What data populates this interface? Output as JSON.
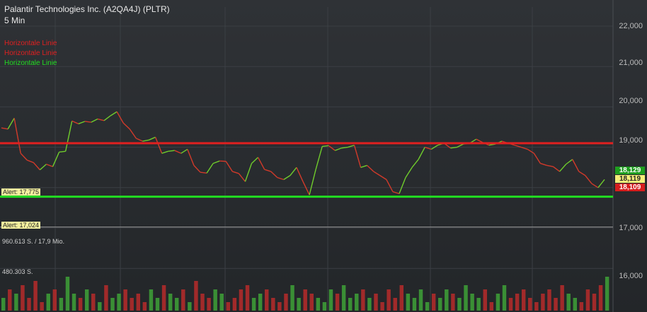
{
  "header": {
    "title": "Palantir Technologies Inc. (A2QA4J) (PLTR)",
    "interval": "5 Min"
  },
  "legend": [
    {
      "label": "Horizontale Linie",
      "color": "#e02020"
    },
    {
      "label": "Horizontale Linie",
      "color": "#e02020"
    },
    {
      "label": "Horizontale Linie",
      "color": "#22dd22"
    }
  ],
  "alerts": [
    "Alert: 17,775",
    "Alert: 17,024"
  ],
  "volume_labels": [
    "960.613 S. / 17,9 Mio.",
    "480.303 S."
  ],
  "y_ticks": [
    "22,000",
    "21,000",
    "20,000",
    "19,000",
    "17,000",
    "16,000"
  ],
  "price_badges": [
    {
      "label": "18,129",
      "bg": "#1f9e1f",
      "fg": "#ffffff"
    },
    {
      "label": "18,119",
      "bg": "#f5ef7a",
      "fg": "#222222"
    },
    {
      "label": "18,109",
      "bg": "#d61e1e",
      "fg": "#ffffff"
    }
  ],
  "chart_data": {
    "type": "line",
    "ylim": [
      15.7,
      22.3
    ],
    "horizontal_lines": [
      {
        "value": 19.1,
        "color": "#e02020"
      },
      {
        "value": 17.775,
        "color": "#22dd22"
      },
      {
        "value": 17.024,
        "color": "#9a9a9a"
      }
    ],
    "price_series": [
      19.48,
      19.45,
      19.72,
      18.85,
      18.68,
      18.62,
      18.44,
      18.58,
      18.52,
      18.88,
      18.9,
      19.65,
      19.58,
      19.64,
      19.62,
      19.7,
      19.66,
      19.78,
      19.88,
      19.6,
      19.45,
      19.22,
      19.15,
      19.18,
      19.25,
      18.85,
      18.9,
      18.92,
      18.85,
      18.95,
      18.55,
      18.38,
      18.36,
      18.6,
      18.66,
      18.65,
      18.4,
      18.35,
      18.15,
      18.6,
      18.75,
      18.45,
      18.4,
      18.25,
      18.2,
      18.3,
      18.5,
      18.15,
      17.82,
      18.45,
      19.02,
      19.04,
      18.92,
      18.98,
      19.0,
      19.05,
      18.5,
      18.55,
      18.4,
      18.3,
      18.2,
      17.9,
      17.85,
      18.25,
      18.5,
      18.7,
      19.0,
      18.95,
      19.05,
      19.1,
      18.98,
      19.0,
      19.08,
      19.1,
      19.2,
      19.12,
      19.05,
      19.08,
      19.15,
      19.1,
      19.05,
      19.0,
      18.95,
      18.85,
      18.6,
      18.55,
      18.52,
      18.4,
      18.58,
      18.7,
      18.4,
      18.3,
      18.1,
      18.0,
      18.2
    ],
    "volume_series": [
      0.3,
      0.5,
      0.4,
      0.6,
      0.3,
      0.7,
      0.2,
      0.4,
      0.5,
      0.3,
      0.8,
      0.4,
      0.3,
      0.5,
      0.4,
      0.2,
      0.6,
      0.3,
      0.4,
      0.5,
      0.3,
      0.4,
      0.2,
      0.5,
      0.3,
      0.6,
      0.4,
      0.3,
      0.5,
      0.2,
      0.7,
      0.4,
      0.3,
      0.5,
      0.4,
      0.2,
      0.3,
      0.5,
      0.6,
      0.3,
      0.4,
      0.5,
      0.3,
      0.2,
      0.4,
      0.6,
      0.3,
      0.5,
      0.4,
      0.3,
      0.2,
      0.5,
      0.4,
      0.6,
      0.3,
      0.4,
      0.5,
      0.3,
      0.4,
      0.2,
      0.5,
      0.3,
      0.6,
      0.4,
      0.3,
      0.5,
      0.2,
      0.4,
      0.3,
      0.5,
      0.4,
      0.3,
      0.6,
      0.4,
      0.3,
      0.5,
      0.2,
      0.4,
      0.6,
      0.3,
      0.4,
      0.5,
      0.3,
      0.2,
      0.4,
      0.5,
      0.3,
      0.6,
      0.4,
      0.3,
      0.2,
      0.5,
      0.4,
      0.6,
      0.8
    ]
  }
}
